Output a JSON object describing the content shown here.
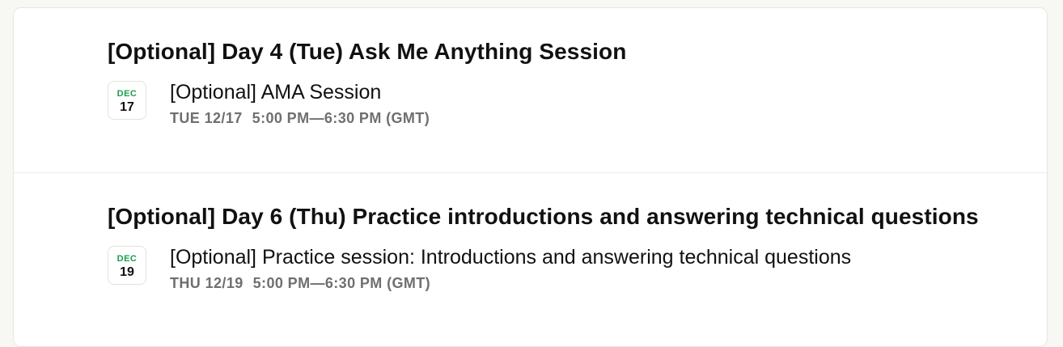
{
  "sections": [
    {
      "title": "[Optional] Day 4 (Tue) Ask Me Anything Session",
      "event": {
        "month": "DEC",
        "day": "17",
        "title": "[Optional] AMA Session",
        "date": "TUE 12/17",
        "time": "5:00 PM—6:30 PM (GMT)"
      }
    },
    {
      "title": "[Optional] Day 6 (Thu) Practice introductions and answering technical questions",
      "event": {
        "month": "DEC",
        "day": "19",
        "title": "[Optional] Practice session: Introductions and answering technical questions",
        "date": "THU 12/19",
        "time": "5:00 PM—6:30 PM (GMT)"
      }
    }
  ],
  "colors": {
    "accent_green": "#1a9e4a",
    "muted_text": "#6f6f6f",
    "border": "#e6e6e3"
  }
}
